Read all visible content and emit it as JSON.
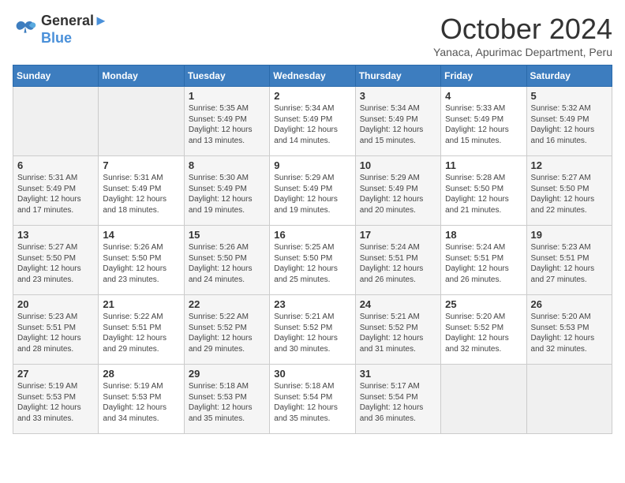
{
  "logo": {
    "line1": "General",
    "line2": "Blue"
  },
  "title": "October 2024",
  "subtitle": "Yanaca, Apurimac Department, Peru",
  "days_of_week": [
    "Sunday",
    "Monday",
    "Tuesday",
    "Wednesday",
    "Thursday",
    "Friday",
    "Saturday"
  ],
  "weeks": [
    [
      {
        "day": "",
        "sunrise": "",
        "sunset": "",
        "daylight": ""
      },
      {
        "day": "",
        "sunrise": "",
        "sunset": "",
        "daylight": ""
      },
      {
        "day": "1",
        "sunrise": "Sunrise: 5:35 AM",
        "sunset": "Sunset: 5:49 PM",
        "daylight": "Daylight: 12 hours and 13 minutes."
      },
      {
        "day": "2",
        "sunrise": "Sunrise: 5:34 AM",
        "sunset": "Sunset: 5:49 PM",
        "daylight": "Daylight: 12 hours and 14 minutes."
      },
      {
        "day": "3",
        "sunrise": "Sunrise: 5:34 AM",
        "sunset": "Sunset: 5:49 PM",
        "daylight": "Daylight: 12 hours and 15 minutes."
      },
      {
        "day": "4",
        "sunrise": "Sunrise: 5:33 AM",
        "sunset": "Sunset: 5:49 PM",
        "daylight": "Daylight: 12 hours and 15 minutes."
      },
      {
        "day": "5",
        "sunrise": "Sunrise: 5:32 AM",
        "sunset": "Sunset: 5:49 PM",
        "daylight": "Daylight: 12 hours and 16 minutes."
      }
    ],
    [
      {
        "day": "6",
        "sunrise": "Sunrise: 5:31 AM",
        "sunset": "Sunset: 5:49 PM",
        "daylight": "Daylight: 12 hours and 17 minutes."
      },
      {
        "day": "7",
        "sunrise": "Sunrise: 5:31 AM",
        "sunset": "Sunset: 5:49 PM",
        "daylight": "Daylight: 12 hours and 18 minutes."
      },
      {
        "day": "8",
        "sunrise": "Sunrise: 5:30 AM",
        "sunset": "Sunset: 5:49 PM",
        "daylight": "Daylight: 12 hours and 19 minutes."
      },
      {
        "day": "9",
        "sunrise": "Sunrise: 5:29 AM",
        "sunset": "Sunset: 5:49 PM",
        "daylight": "Daylight: 12 hours and 19 minutes."
      },
      {
        "day": "10",
        "sunrise": "Sunrise: 5:29 AM",
        "sunset": "Sunset: 5:49 PM",
        "daylight": "Daylight: 12 hours and 20 minutes."
      },
      {
        "day": "11",
        "sunrise": "Sunrise: 5:28 AM",
        "sunset": "Sunset: 5:50 PM",
        "daylight": "Daylight: 12 hours and 21 minutes."
      },
      {
        "day": "12",
        "sunrise": "Sunrise: 5:27 AM",
        "sunset": "Sunset: 5:50 PM",
        "daylight": "Daylight: 12 hours and 22 minutes."
      }
    ],
    [
      {
        "day": "13",
        "sunrise": "Sunrise: 5:27 AM",
        "sunset": "Sunset: 5:50 PM",
        "daylight": "Daylight: 12 hours and 23 minutes."
      },
      {
        "day": "14",
        "sunrise": "Sunrise: 5:26 AM",
        "sunset": "Sunset: 5:50 PM",
        "daylight": "Daylight: 12 hours and 23 minutes."
      },
      {
        "day": "15",
        "sunrise": "Sunrise: 5:26 AM",
        "sunset": "Sunset: 5:50 PM",
        "daylight": "Daylight: 12 hours and 24 minutes."
      },
      {
        "day": "16",
        "sunrise": "Sunrise: 5:25 AM",
        "sunset": "Sunset: 5:50 PM",
        "daylight": "Daylight: 12 hours and 25 minutes."
      },
      {
        "day": "17",
        "sunrise": "Sunrise: 5:24 AM",
        "sunset": "Sunset: 5:51 PM",
        "daylight": "Daylight: 12 hours and 26 minutes."
      },
      {
        "day": "18",
        "sunrise": "Sunrise: 5:24 AM",
        "sunset": "Sunset: 5:51 PM",
        "daylight": "Daylight: 12 hours and 26 minutes."
      },
      {
        "day": "19",
        "sunrise": "Sunrise: 5:23 AM",
        "sunset": "Sunset: 5:51 PM",
        "daylight": "Daylight: 12 hours and 27 minutes."
      }
    ],
    [
      {
        "day": "20",
        "sunrise": "Sunrise: 5:23 AM",
        "sunset": "Sunset: 5:51 PM",
        "daylight": "Daylight: 12 hours and 28 minutes."
      },
      {
        "day": "21",
        "sunrise": "Sunrise: 5:22 AM",
        "sunset": "Sunset: 5:51 PM",
        "daylight": "Daylight: 12 hours and 29 minutes."
      },
      {
        "day": "22",
        "sunrise": "Sunrise: 5:22 AM",
        "sunset": "Sunset: 5:52 PM",
        "daylight": "Daylight: 12 hours and 29 minutes."
      },
      {
        "day": "23",
        "sunrise": "Sunrise: 5:21 AM",
        "sunset": "Sunset: 5:52 PM",
        "daylight": "Daylight: 12 hours and 30 minutes."
      },
      {
        "day": "24",
        "sunrise": "Sunrise: 5:21 AM",
        "sunset": "Sunset: 5:52 PM",
        "daylight": "Daylight: 12 hours and 31 minutes."
      },
      {
        "day": "25",
        "sunrise": "Sunrise: 5:20 AM",
        "sunset": "Sunset: 5:52 PM",
        "daylight": "Daylight: 12 hours and 32 minutes."
      },
      {
        "day": "26",
        "sunrise": "Sunrise: 5:20 AM",
        "sunset": "Sunset: 5:53 PM",
        "daylight": "Daylight: 12 hours and 32 minutes."
      }
    ],
    [
      {
        "day": "27",
        "sunrise": "Sunrise: 5:19 AM",
        "sunset": "Sunset: 5:53 PM",
        "daylight": "Daylight: 12 hours and 33 minutes."
      },
      {
        "day": "28",
        "sunrise": "Sunrise: 5:19 AM",
        "sunset": "Sunset: 5:53 PM",
        "daylight": "Daylight: 12 hours and 34 minutes."
      },
      {
        "day": "29",
        "sunrise": "Sunrise: 5:18 AM",
        "sunset": "Sunset: 5:53 PM",
        "daylight": "Daylight: 12 hours and 35 minutes."
      },
      {
        "day": "30",
        "sunrise": "Sunrise: 5:18 AM",
        "sunset": "Sunset: 5:54 PM",
        "daylight": "Daylight: 12 hours and 35 minutes."
      },
      {
        "day": "31",
        "sunrise": "Sunrise: 5:17 AM",
        "sunset": "Sunset: 5:54 PM",
        "daylight": "Daylight: 12 hours and 36 minutes."
      },
      {
        "day": "",
        "sunrise": "",
        "sunset": "",
        "daylight": ""
      },
      {
        "day": "",
        "sunrise": "",
        "sunset": "",
        "daylight": ""
      }
    ]
  ]
}
